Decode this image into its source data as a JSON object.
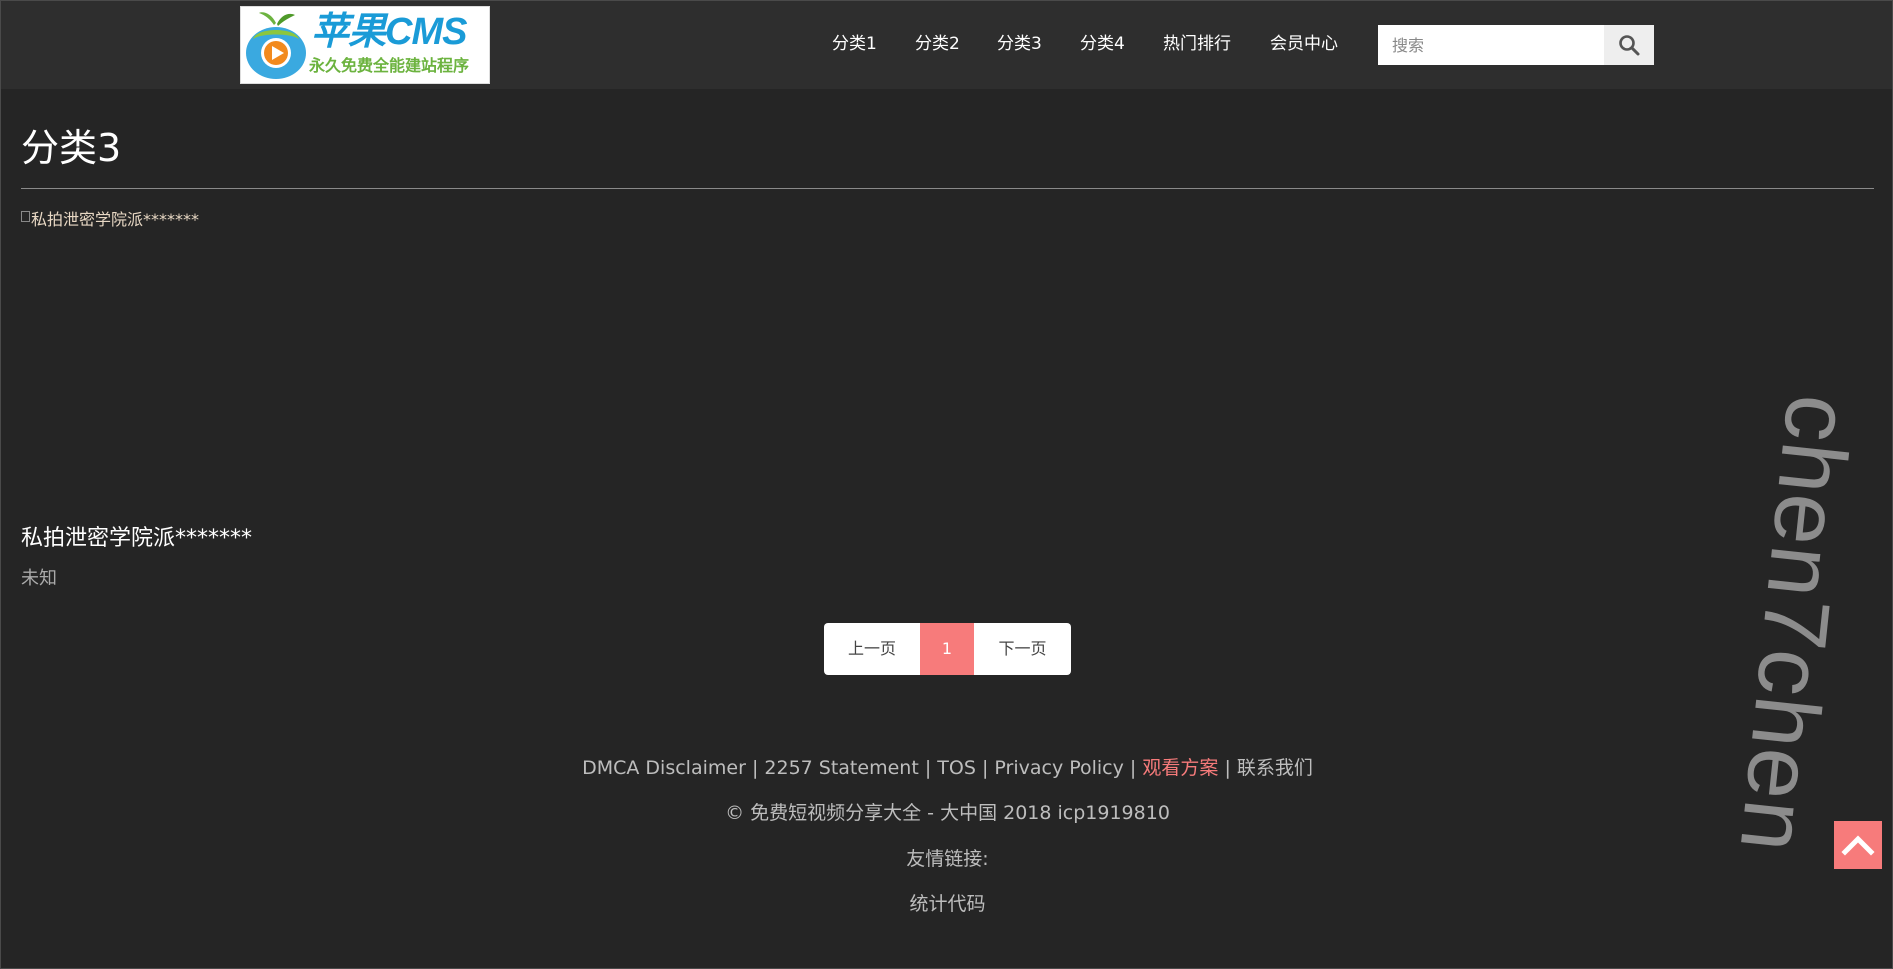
{
  "header": {
    "logo": {
      "title": "苹果CMS",
      "subtitle": "永久免费全能建站程序"
    },
    "nav": [
      {
        "label": "分类1"
      },
      {
        "label": "分类2"
      },
      {
        "label": "分类3"
      },
      {
        "label": "分类4"
      },
      {
        "label": "热门排行"
      },
      {
        "label": "会员中心"
      }
    ],
    "search": {
      "placeholder": "搜索",
      "value": ""
    }
  },
  "main": {
    "title": "分类3",
    "items": [
      {
        "image_alt": "私拍泄密学院派*******",
        "title": "私拍泄密学院派*******",
        "meta": "未知"
      }
    ]
  },
  "pagination": {
    "prev": "上一页",
    "current": "1",
    "next": "下一页"
  },
  "footer": {
    "links": [
      {
        "label": "DMCA Disclaimer"
      },
      {
        "label": "2257 Statement"
      },
      {
        "label": "TOS"
      },
      {
        "label": "Privacy Policy"
      },
      {
        "label": "观看方案"
      },
      {
        "label": "联系我们"
      }
    ],
    "separator": "|",
    "copyright": "© 免费短视频分享大全 - 大中国 2018 icp1919810",
    "friend_links": "友情链接:",
    "stats": "统计代码"
  },
  "watermark": "chen7chen",
  "colors": {
    "background": "#252525",
    "header": "#2e2e2e",
    "accent": "#f77b7b"
  },
  "icons": {
    "search": "search-icon",
    "back_to_top": "chevron-up-icon"
  }
}
